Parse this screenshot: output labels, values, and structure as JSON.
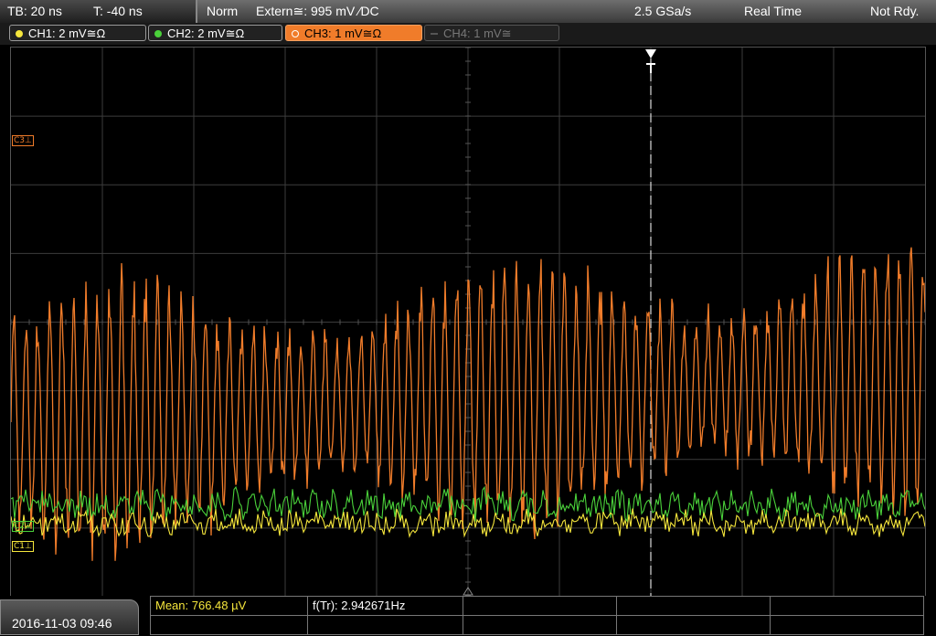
{
  "status": {
    "timebase": "TB: 20 ns",
    "trigger_time": "T: -40 ns",
    "mode": "Norm",
    "trigger_source": "Extern≅: 995 mV ⁄DC",
    "sample_rate": "2.5 GSa/s",
    "acq_mode": "Real Time",
    "state": "Not Rdy."
  },
  "channels": [
    {
      "label": "CH1: 2 mV≅Ω",
      "color": "#f5e63c",
      "active": false,
      "enabled": true
    },
    {
      "label": "CH2: 2 mV≅Ω",
      "color": "#4ad13a",
      "active": false,
      "enabled": true
    },
    {
      "label": "CH3: 1 mV≅Ω",
      "color": "#f07c2a",
      "active": true,
      "enabled": true
    },
    {
      "label": "CH4: 1 mV≅",
      "color": "#777777",
      "active": false,
      "enabled": false
    }
  ],
  "markers": {
    "c3": "C3⊥",
    "c1": "C1⊥",
    "c2": "C2⊥"
  },
  "datetime": "2016-11-03 09:46",
  "measurements": {
    "mean": "Mean: 766.48 µV",
    "freq": "f(Tr): 2.942671Hz"
  },
  "colors": {
    "ch1": "#f5e63c",
    "ch2": "#4ad13a",
    "ch3": "#f07c2a",
    "grid": "#3c3c3c"
  }
}
